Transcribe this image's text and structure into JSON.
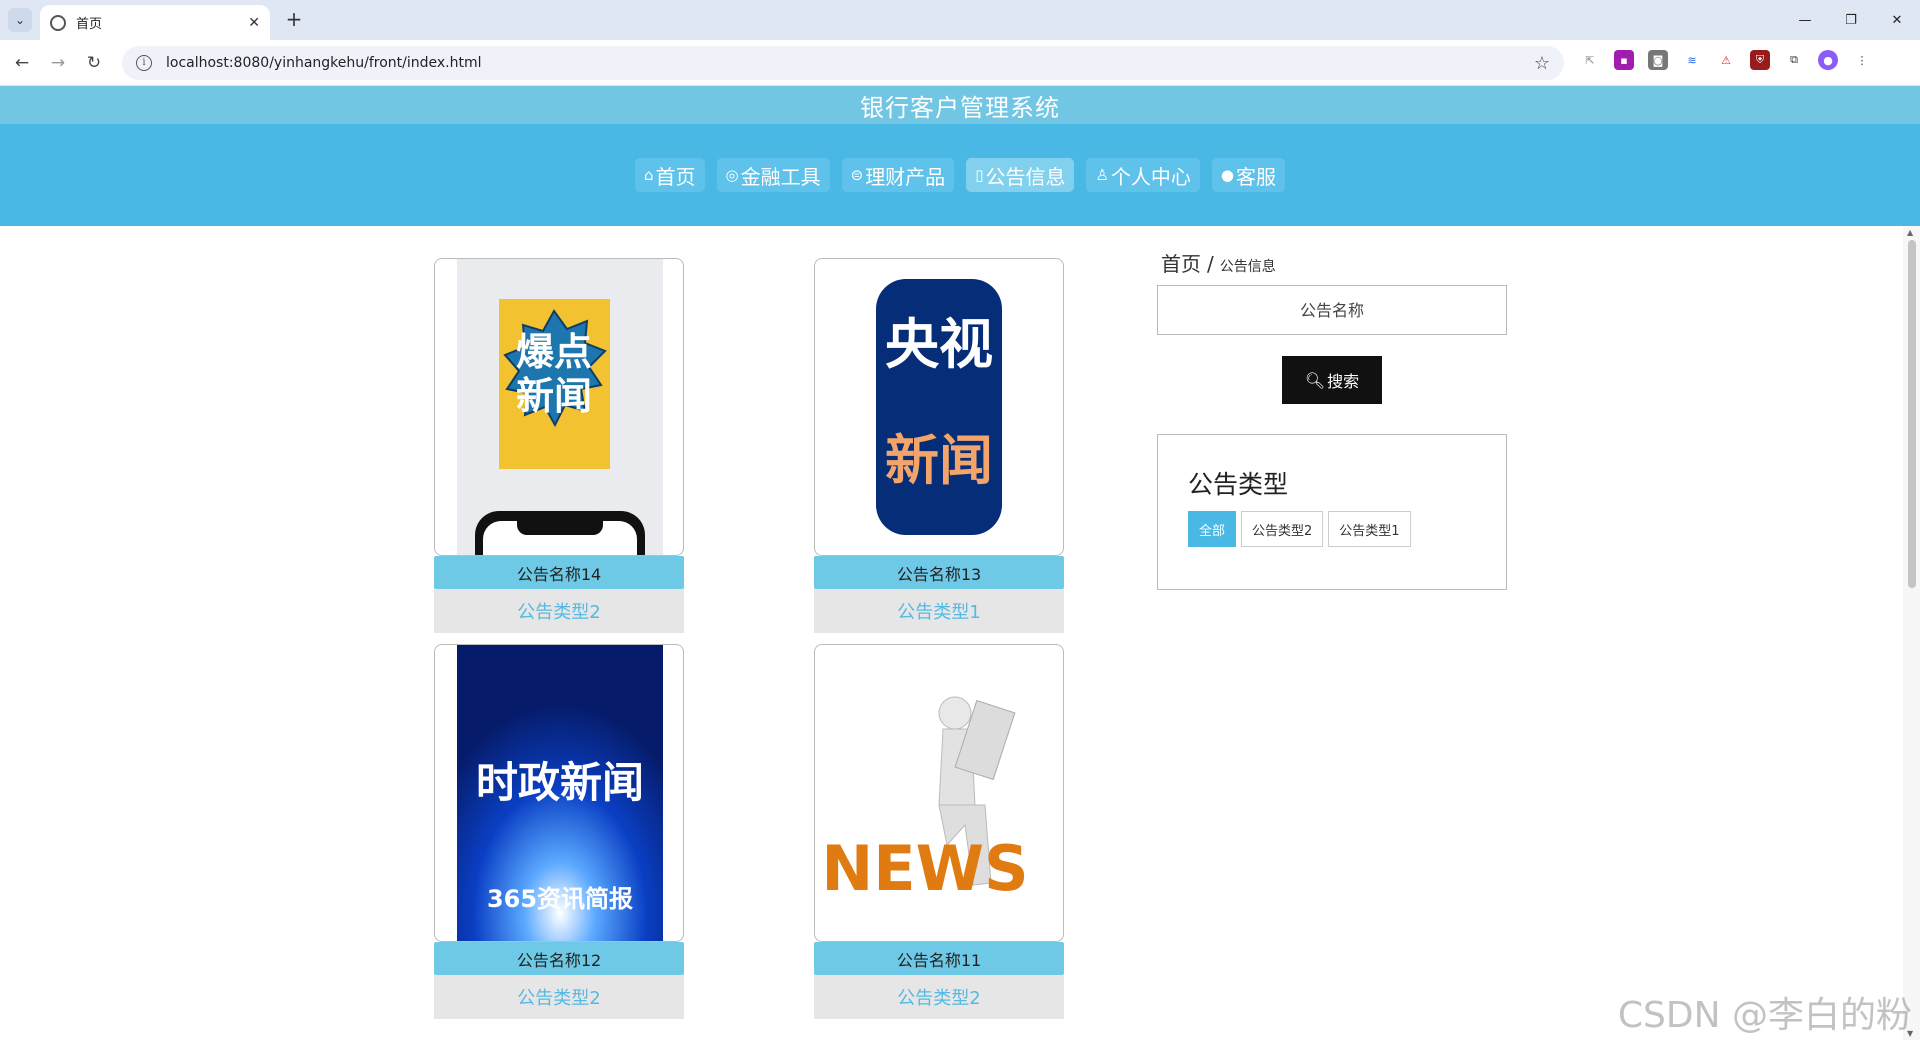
{
  "browser": {
    "tab_title": "首页",
    "url": "localhost:8080/yinhangkehu/front/index.html"
  },
  "site": {
    "title": "银行客户管理系统",
    "nav": [
      {
        "label": "首页",
        "icon": "home-icon",
        "glyph": "⌂"
      },
      {
        "label": "金融工具",
        "icon": "tool-icon",
        "glyph": "◎"
      },
      {
        "label": "理财产品",
        "icon": "product-icon",
        "glyph": "⊜"
      },
      {
        "label": "公告信息",
        "icon": "notice-icon",
        "glyph": "▯"
      },
      {
        "label": "个人中心",
        "icon": "user-icon",
        "glyph": "♙"
      },
      {
        "label": "客服",
        "icon": "service-icon",
        "glyph": "●"
      }
    ],
    "active_nav": "公告信息"
  },
  "breadcrumb": {
    "home": "首页",
    "sep": "/",
    "current": "公告信息"
  },
  "search": {
    "placeholder": "公告名称",
    "button_label": "搜索"
  },
  "type_filter": {
    "title": "公告类型",
    "tags": [
      "全部",
      "公告类型2",
      "公告类型1"
    ],
    "active": "全部"
  },
  "notices": [
    {
      "name": "公告名称14",
      "type": "公告类型2",
      "image_text": [
        "爆点",
        "新闻"
      ]
    },
    {
      "name": "公告名称13",
      "type": "公告类型1",
      "image_text": [
        "央视",
        "新闻"
      ]
    },
    {
      "name": "公告名称12",
      "type": "公告类型2",
      "image_text": [
        "时政新闻",
        "365资讯简报"
      ]
    },
    {
      "name": "公告名称11",
      "type": "公告类型2",
      "image_text": [
        "NEWS"
      ]
    }
  ],
  "watermark": "CSDN @李白的粉",
  "colors": {
    "header": "#71c6e3",
    "nav": "#4ab8e4",
    "name_bar": "#6ec9e6",
    "type_text": "#55b9e2"
  }
}
